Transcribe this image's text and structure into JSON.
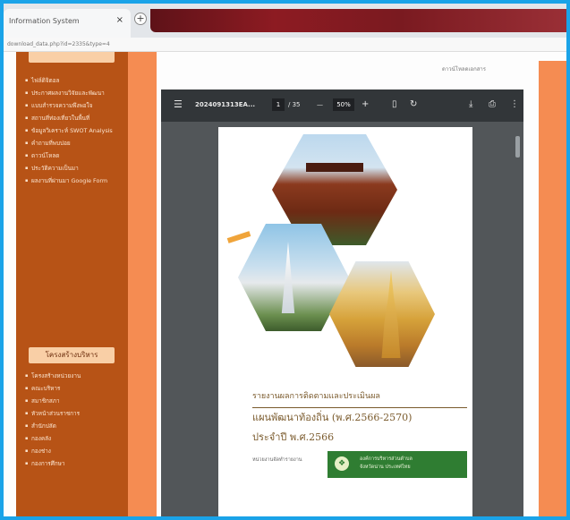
{
  "browser": {
    "tab_title": "Information System",
    "close_icon": "×",
    "newtab_icon": "+",
    "url": "download_data.php?id=2335&type=4"
  },
  "sidebar": {
    "items_top": [
      "ไฟล์ดิจิตอล",
      "ประกาศผลงานวิจัยและพัฒนา",
      "แบบสำรวจความพึงพอใจ",
      "สถานที่ท่องเที่ยวในพื้นที่",
      "ข้อมูลวิเคราะห์ SWOT Analysis",
      "คำถามที่พบบ่อย",
      "ดาวน์โหลด",
      "ประวัติความเป็นมา",
      "ผลงานที่ผ่านมา Google Form"
    ],
    "section_label": "โครงสร้างบริหาร",
    "items_bottom": [
      "โครงสร้างหน่วยงาน",
      "คณะบริหาร",
      "สมาชิกสภา",
      "หัวหน้าส่วนราชการ",
      "สำนักปลัด",
      "กองคลัง",
      "กองช่าง",
      "กองการศึกษา"
    ]
  },
  "share_link": "ดาวน์โหลดเอกสาร",
  "viewer": {
    "menu_icon": "☰",
    "filename": "2024091313EA...",
    "page_current": "1",
    "page_total": "/ 35",
    "zoom_out": "—",
    "zoom_value": "50%",
    "zoom_in": "+",
    "fit_icon": "▯",
    "rotate_icon": "↻",
    "download_icon": "⤓",
    "print_icon": "⎙",
    "more_icon": "⋮"
  },
  "document": {
    "title_line1": "รายงานผลการติดตามและประเมินผล",
    "title_line2": "แผนพัฒนาท้องถิ่น (พ.ศ.2566-2570)",
    "title_line3": "ประจำปี พ.ศ.2566",
    "org_line": "หน่วยงานจัดทำรายงาน",
    "badge_line1": "องค์การบริหารส่วนตำบล",
    "badge_line2": "จังหวัดน่าน ประเทศไทย",
    "badge_icon": "❖"
  }
}
